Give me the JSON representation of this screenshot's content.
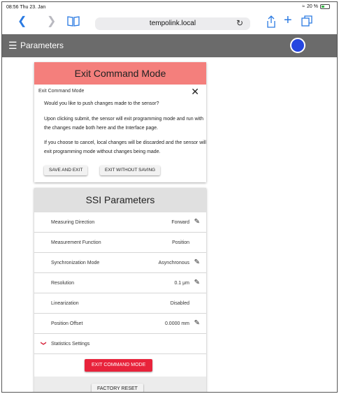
{
  "status_bar": {
    "time": "08:56  Thu 23. Jan",
    "battery": "20 %"
  },
  "browser": {
    "url": "tempolink.local",
    "back_icon": "chevron-left-icon",
    "forward_icon": "chevron-right-icon",
    "bookmarks_icon": "book-icon",
    "reload_icon": "reload-icon",
    "share_icon": "share-icon",
    "new_tab_icon": "plus-icon",
    "tabs_icon": "tabs-icon"
  },
  "app_bar": {
    "title": "Parameters",
    "avatar_color": "#2546e0"
  },
  "exit_card": {
    "header": "Exit Command Mode",
    "header_color": "#f47f7c",
    "dialog_title": "Exit Command Mode",
    "question": "Would you like to push changes made to the sensor?",
    "submit_text": "Upon clicking submit, the sensor will exit programming mode and run with the changes made both here and the Interface page.",
    "cancel_text": "If you choose to cancel, local changes will be discarded and the sensor will exit programming mode without changes being made.",
    "save_button": "SAVE AND EXIT",
    "exit_button": "EXIT WITHOUT SAVING"
  },
  "ssi_card": {
    "header": "SSI Parameters",
    "rows": [
      {
        "label": "Measuring Direction",
        "value": "Forward",
        "editable": true
      },
      {
        "label": "Measurement Function",
        "value": "Position",
        "editable": false
      },
      {
        "label": "Synchronization Mode",
        "value": "Asynchronous",
        "editable": true
      },
      {
        "label": "Resolution",
        "value": "0.1 μm",
        "editable": true
      },
      {
        "label": "Linearization",
        "value": "Disabled",
        "editable": false
      },
      {
        "label": "Position Offset",
        "value": "0.0000 mm",
        "editable": true
      }
    ],
    "statistics_label": "Statistics Settings",
    "exit_command_button": "EXIT COMMAND MODE",
    "exit_command_color": "#e8233b",
    "factory_reset_button": "FACTORY RESET"
  }
}
